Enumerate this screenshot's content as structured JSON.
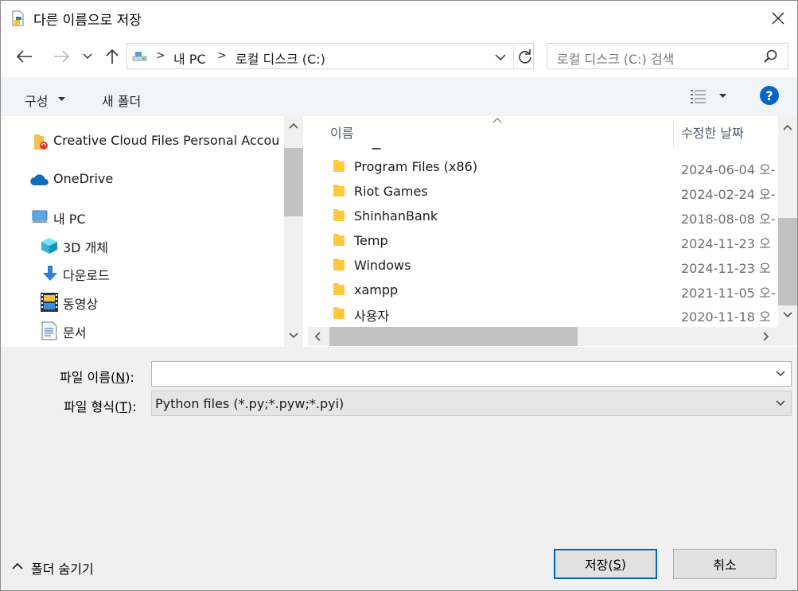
{
  "window": {
    "title": "다른 이름으로 저장"
  },
  "address": {
    "crumbs": [
      "내 PC",
      "로컬 디스크 (C:)"
    ]
  },
  "search": {
    "placeholder": "로컬 디스크 (C:) 검색"
  },
  "toolbar": {
    "organize_label": "구성",
    "new_folder_label": "새 폴더"
  },
  "nav": {
    "items": [
      {
        "label": "Creative Cloud Files Personal Accou",
        "icon": "creative-cloud-folder-icon"
      },
      {
        "label": "OneDrive",
        "icon": "onedrive-cloud-icon"
      },
      {
        "label": "내 PC",
        "icon": "computer-icon"
      },
      {
        "label": "3D 개체",
        "icon": "3d-cube-icon"
      },
      {
        "label": "다운로드",
        "icon": "download-arrow-icon"
      },
      {
        "label": "동영상",
        "icon": "video-film-icon"
      },
      {
        "label": "문서",
        "icon": "document-icon"
      }
    ]
  },
  "files": {
    "columns": {
      "name": "이름",
      "date": "수정한 날짜"
    },
    "rows": [
      {
        "name": "Program Files (x86)",
        "date": "2024-06-04 오-"
      },
      {
        "name": "Riot Games",
        "date": "2024-02-24 오-"
      },
      {
        "name": "ShinhanBank",
        "date": "2018-08-08 오-"
      },
      {
        "name": "Temp",
        "date": "2024-11-23 오"
      },
      {
        "name": "Windows",
        "date": "2024-11-23 오"
      },
      {
        "name": "xampp",
        "date": "2021-11-05 오-"
      },
      {
        "name": "사용자",
        "date": "2020-11-18 오"
      }
    ]
  },
  "form": {
    "filename_label_pre": "파일 이름(",
    "filename_label_key": "N",
    "filename_label_post": "):",
    "filename_value": "",
    "filetype_label_pre": "파일 형식(",
    "filetype_label_key": "T",
    "filetype_label_post": "):",
    "filetype_value": "Python files (*.py;*.pyw;*.pyi)"
  },
  "footer": {
    "hide_folders_label": "폴더 숨기기",
    "save_label_pre": "저장(",
    "save_label_key": "S",
    "save_label_post": ")",
    "cancel_label": "취소"
  },
  "colors": {
    "accent": "#0067c0",
    "help": "#0a63c9",
    "toolbar_bg": "#f0f4f9",
    "folder": "#ffc83d"
  }
}
